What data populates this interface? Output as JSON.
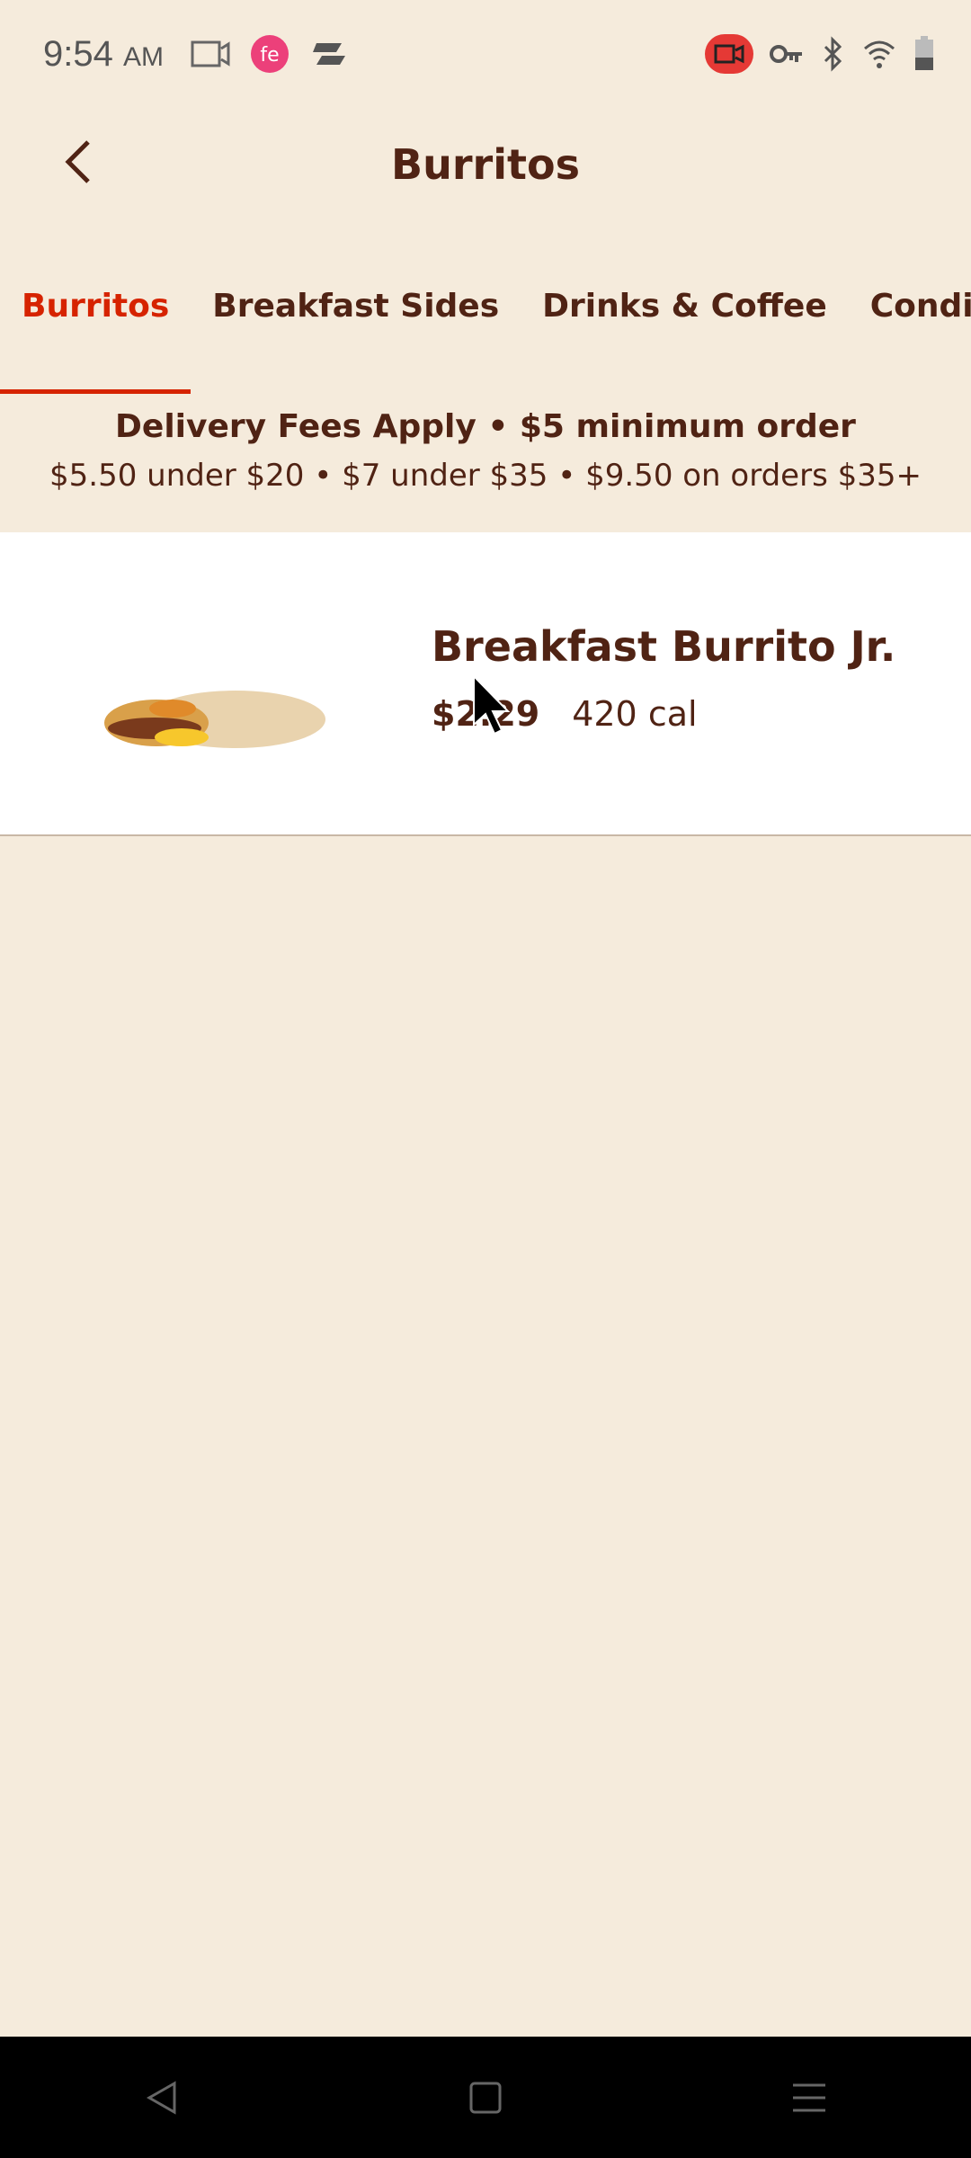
{
  "status_bar": {
    "time": "9:54",
    "ampm": "AM",
    "icons": [
      "video-camera-icon",
      "app-notification-icon",
      "sync-icon",
      "screen-record-icon",
      "vpn-key-icon",
      "bluetooth-icon",
      "wifi-icon",
      "battery-icon"
    ],
    "record_color": "#e53935"
  },
  "header": {
    "title": "Burritos",
    "back_icon": "chevron-left-icon"
  },
  "tabs": [
    {
      "label": "Burritos",
      "active": true
    },
    {
      "label": "Breakfast Sides"
    },
    {
      "label": "Drinks & Coffee"
    },
    {
      "label": "Condiments"
    }
  ],
  "banner": {
    "line1": "Delivery Fees Apply • $5 minimum order",
    "line2": "$5.50 under $20 • $7 under $35 • $9.50 on orders $35+"
  },
  "items": [
    {
      "name": "Breakfast Burrito Jr.",
      "price": "$2.29",
      "calories": "420 cal"
    }
  ],
  "colors": {
    "accent": "#d62300",
    "text": "#502314",
    "background": "#f5ebdc"
  }
}
